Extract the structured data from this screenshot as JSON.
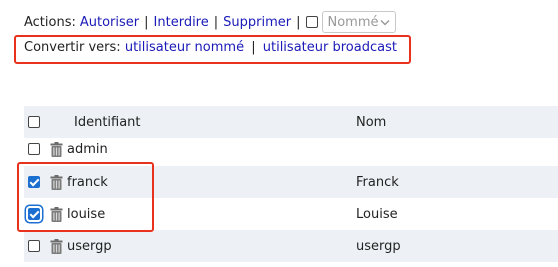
{
  "actions": {
    "label": "Actions:",
    "allow": "Autoriser",
    "deny": "Interdire",
    "delete": "Supprimer",
    "pipe": "|",
    "type_select": {
      "value": "Nommé"
    }
  },
  "convert": {
    "label": "Convertir vers:",
    "named_user": "utilisateur nommé",
    "pipe": "|",
    "broadcast_user": "utilisateur broadcast"
  },
  "table": {
    "columns": [
      "Identifiant",
      "Nom"
    ],
    "rows": [
      {
        "id": "admin",
        "name": "",
        "checked": false
      },
      {
        "id": "franck",
        "name": "Franck",
        "checked": true
      },
      {
        "id": "louise",
        "name": "Louise",
        "checked": true
      },
      {
        "id": "usergp",
        "name": "usergp",
        "checked": false
      }
    ]
  },
  "colors": {
    "link": "#1a1ab8",
    "highlight": "#e8321e",
    "checkbox_checked": "#1a6fd1",
    "row_stripe": "#edf1f5"
  },
  "icons": {
    "delete_row": "trash-icon",
    "select_arrow": "chevron-down-icon"
  }
}
